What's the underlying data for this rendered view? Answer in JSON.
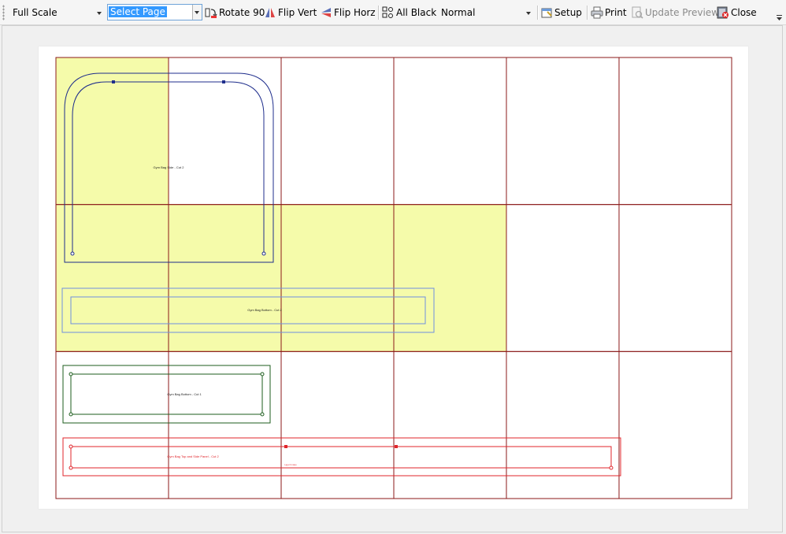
{
  "toolbar": {
    "scale_value": "Full Scale",
    "page_value": "Select Page",
    "rotate_label": "Rotate 90",
    "flip_vert_label": "Flip Vert",
    "flip_horz_label": "Flip Horz",
    "all_black_label": "All Black",
    "mode_value": "Normal",
    "setup_label": "Setup",
    "print_label": "Print",
    "update_preview_label": "Update Preview",
    "close_label": "Close"
  },
  "preview": {
    "grid": {
      "columns": 6,
      "rows": 3
    },
    "highlighted_pages": [
      [
        0,
        0
      ],
      [
        0,
        1
      ],
      [
        1,
        1
      ],
      [
        2,
        1
      ],
      [
        3,
        1
      ]
    ],
    "parts": {
      "sides": "Gym Bag Side - Cut 2",
      "bottom_long": "Gym Bag Bottom - Cut 2",
      "bottom": "Gym Bag Bottom - Cut 1",
      "top_side_panel": "Gym Bag Top and Side Panel - Cut 2",
      "top_side_panel_sub": "Layer 0 notes"
    }
  },
  "colors": {
    "grid_line": "#8b1a1a",
    "page_highlight": "#f5fbaa",
    "sides_outline": "#1f2e8c",
    "bottom_long_outline": "#6f8fe0",
    "bottom_outline": "#1e5e1e",
    "top_panel_outline": "#e0252b"
  }
}
